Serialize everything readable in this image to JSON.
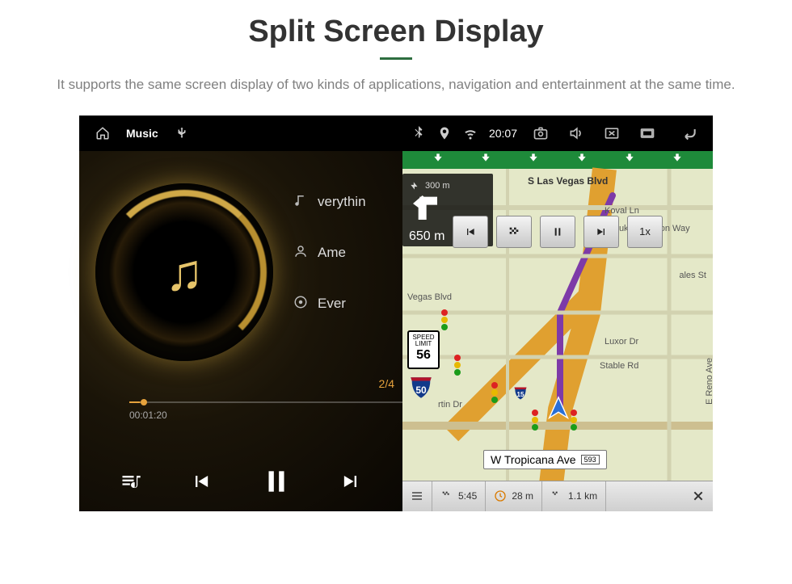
{
  "page": {
    "title": "Split Screen Display",
    "subtitle": "It supports the same screen display of two kinds of applications, navigation and entertainment at the same time."
  },
  "status": {
    "label": "Music",
    "time": "20:07"
  },
  "music": {
    "row1": "verythin",
    "row2": "Ame",
    "row3": "Ever",
    "track_count": "2/4",
    "elapsed": "00:01:20"
  },
  "nav": {
    "main_distance": "650 m",
    "sub_distance": "300 m",
    "speed_limit_label": "SPEED LIMIT",
    "speed_limit_value": "56",
    "highway": "50",
    "mini_hwy": "15",
    "overlay_speed": "1x",
    "current_street": "W Tropicana Ave",
    "current_street_code": "593",
    "labels": {
      "s_las_vegas": "S Las Vegas Blvd",
      "koval": "Koval Ln",
      "duke": "Duke Ellington Way",
      "ales": "ales St",
      "vegas_blvd": "Vegas Blvd",
      "luxor": "Luxor Dr",
      "stable": "Stable Rd",
      "reno": "E Reno Ave",
      "martin": "rtin Dr"
    },
    "bottom": {
      "eta": "5:45",
      "travel_time": "28 m",
      "remaining": "1.1 km"
    }
  }
}
